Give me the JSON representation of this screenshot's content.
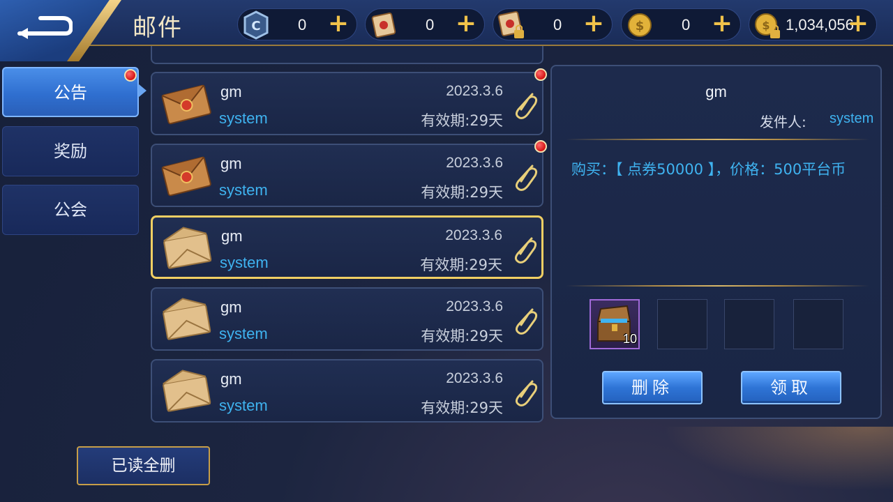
{
  "header": {
    "title": "邮件",
    "currencies": [
      {
        "icon": "coupon-token-icon",
        "value": "0"
      },
      {
        "icon": "scroll-icon",
        "value": "0"
      },
      {
        "icon": "locked-scroll-icon",
        "value": "0"
      },
      {
        "icon": "gold-coin-icon",
        "value": "0"
      },
      {
        "icon": "locked-gold-coin-icon",
        "value": "1,034,056"
      }
    ]
  },
  "tabs": [
    {
      "label": "公告",
      "active": true,
      "badge": true
    },
    {
      "label": "奖励",
      "active": false,
      "badge": false
    },
    {
      "label": "公会",
      "active": false,
      "badge": false
    }
  ],
  "mails": [
    {
      "sender": "gm",
      "from": "system",
      "date": "2023.3.6",
      "expire": "有效期:29天",
      "icon": "sealed-envelope-icon",
      "unread": true
    },
    {
      "sender": "gm",
      "from": "system",
      "date": "2023.3.6",
      "expire": "有效期:29天",
      "icon": "sealed-envelope-icon",
      "unread": true
    },
    {
      "sender": "gm",
      "from": "system",
      "date": "2023.3.6",
      "expire": "有效期:29天",
      "icon": "open-envelope-icon",
      "unread": false,
      "selected": true
    },
    {
      "sender": "gm",
      "from": "system",
      "date": "2023.3.6",
      "expire": "有效期:29天",
      "icon": "open-envelope-icon",
      "unread": false
    },
    {
      "sender": "gm",
      "from": "system",
      "date": "2023.3.6",
      "expire": "有效期:29天",
      "icon": "open-envelope-icon",
      "unread": false
    }
  ],
  "detail": {
    "title": "gm",
    "sender_label": "发件人:",
    "sender": "system",
    "content": "购买：【 点券50000 】，价格：500平台币",
    "attachments": [
      {
        "icon": "treasure-chest-icon",
        "count": "10"
      },
      {
        "icon": null,
        "count": ""
      },
      {
        "icon": null,
        "count": ""
      },
      {
        "icon": null,
        "count": ""
      }
    ],
    "delete_label": "删除",
    "claim_label": "领取"
  },
  "bottom": {
    "delete_all_read_label": "已读全删"
  },
  "colors": {
    "accent_blue": "#3fb3f0",
    "gold": "#f1cf63",
    "badge_red": "#d41414"
  }
}
